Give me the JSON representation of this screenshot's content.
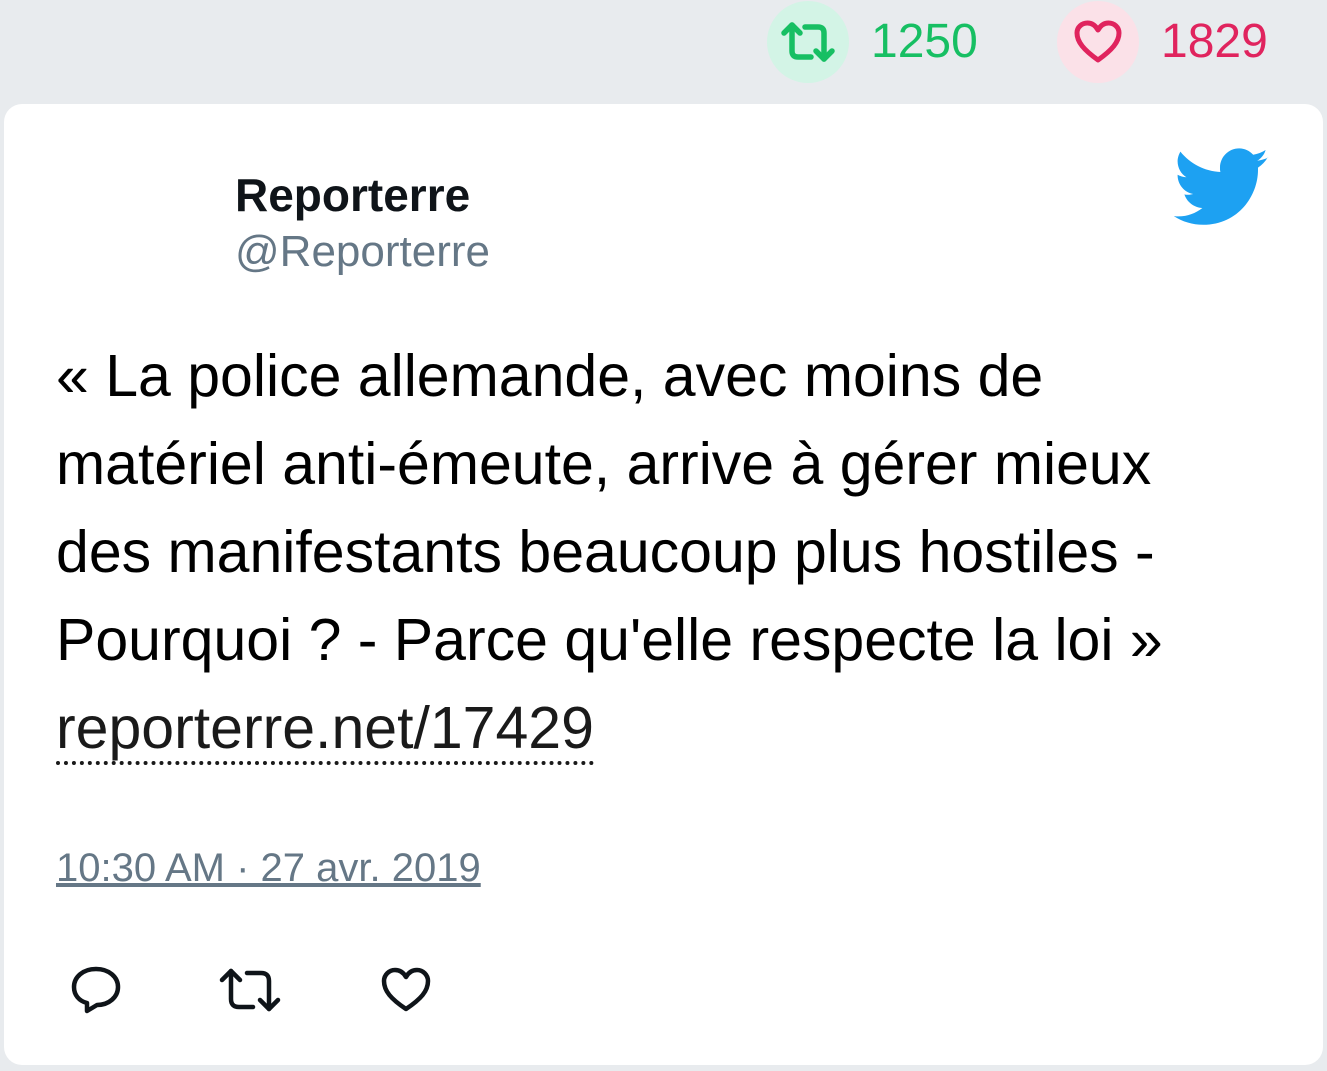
{
  "stats": {
    "retweet_count": "1250",
    "like_count": "1829",
    "retweet_color": "#17bf63",
    "like_color": "#e0245e"
  },
  "tweet": {
    "display_name": "Reporterre",
    "handle": "@Reporterre",
    "text": "« La police allemande, avec moins de matériel anti-émeute, arrive à gérer mieux des manifestants beaucoup plus hostiles - Pourquoi ? - Parce qu'elle respecte la loi » ",
    "link_text": "reporterre.net/17429",
    "timestamp": "10:30 AM · 27 avr. 2019"
  },
  "icons": {
    "brand": "twitter-bird-icon",
    "reply": "reply-icon",
    "retweet": "retweet-icon",
    "like": "heart-icon",
    "brand_color": "#1da1f2"
  }
}
